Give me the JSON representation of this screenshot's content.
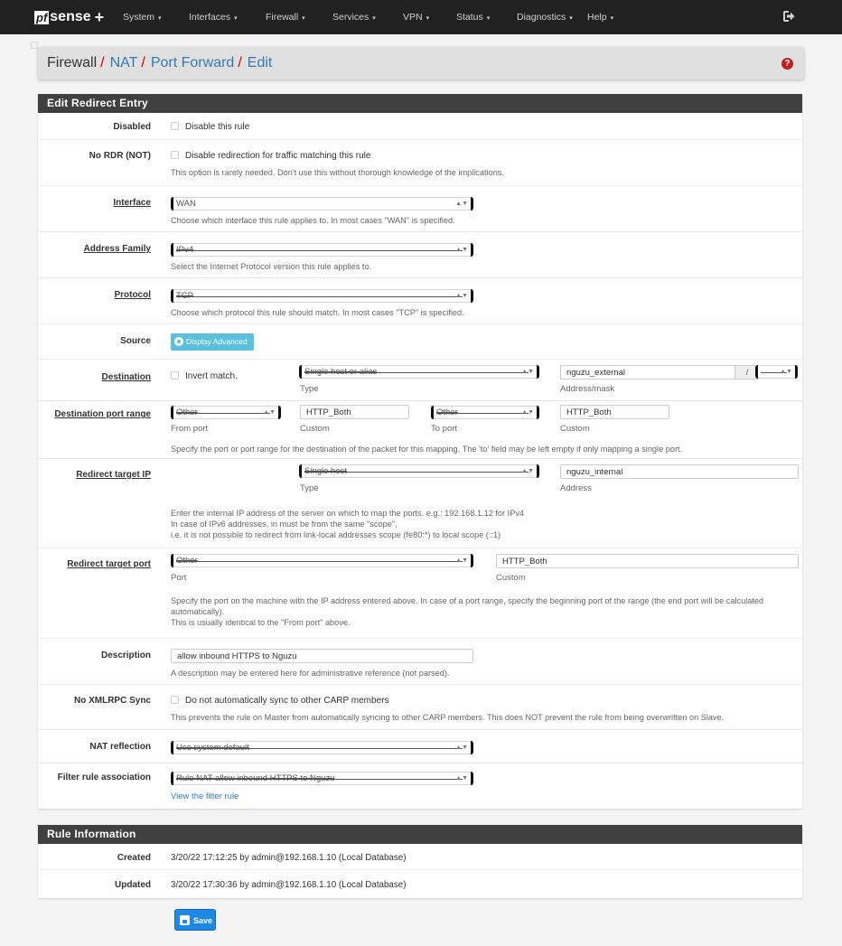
{
  "navbar": {
    "brand_pf": "pf",
    "brand_name": "sense",
    "brand_plus": "+",
    "menu": [
      "System",
      "Interfaces",
      "Firewall",
      "Services",
      "VPN",
      "Status",
      "Diagnostics",
      "Help"
    ],
    "caret": "▾",
    "logout_icon": "sign-out-icon"
  },
  "breadcrumb": {
    "items": [
      {
        "label": "Firewall",
        "link": false
      },
      {
        "label": "NAT",
        "link": true
      },
      {
        "label": "Port Forward",
        "link": true
      },
      {
        "label": "Edit",
        "link": true
      }
    ],
    "separator": "/",
    "help_icon": "?"
  },
  "colors": {
    "navbar_bg": "#212121",
    "panel_heading_bg": "#404040",
    "link": "#337ab7",
    "separator": "#cc0000",
    "info_button": "#5bc0de",
    "primary_button": "#1e88e5",
    "help_icon": "#c21e1e"
  },
  "edit_panel": {
    "title": "Edit Redirect Entry",
    "disabled": {
      "label": "Disabled",
      "checkbox_label": "Disable this rule",
      "checked": false
    },
    "no_rdr": {
      "label": "No RDR (NOT)",
      "checkbox_label": "Disable redirection for traffic matching this rule",
      "checked": false,
      "help": "This option is rarely needed. Don't use this without thorough knowledge of the implications."
    },
    "interface": {
      "label": "Interface",
      "value": "WAN",
      "help": "Choose which interface this rule applies to. In most cases \"WAN\" is specified."
    },
    "address_family": {
      "label": "Address Family",
      "value": "IPv4",
      "help": "Select the Internet Protocol version this rule applies to."
    },
    "protocol": {
      "label": "Protocol",
      "value": "TCP",
      "help": "Choose which protocol this rule should match. In most cases \"TCP\" is specified."
    },
    "source": {
      "label": "Source",
      "button": "Display Advanced"
    },
    "destination": {
      "label": "Destination",
      "invert_label": "Invert match.",
      "invert_checked": false,
      "type_value": "Single host or alias",
      "type_sub": "Type",
      "address_value": "nguzu_external",
      "mask_sep": "/",
      "mask_value": "",
      "address_sub": "Address/mask"
    },
    "dest_port_range": {
      "label": "Destination port range",
      "from_select": "Other",
      "from_sub": "From port",
      "from_custom": "HTTP_Both",
      "from_custom_sub": "Custom",
      "to_select": "Other",
      "to_sub": "To port",
      "to_custom": "HTTP_Both",
      "to_custom_sub": "Custom",
      "help": "Specify the port or port range for the destination of the packet for this mapping. The 'to' field may be left empty if only mapping a single port."
    },
    "redirect_ip": {
      "label": "Redirect target IP",
      "type_value": "Single host",
      "type_sub": "Type",
      "address_value": "nguzu_internal",
      "address_sub": "Address",
      "help_lines": [
        "Enter the internal IP address of the server on which to map the ports. e.g.: 192.168.1.12 for IPv4",
        "In case of IPv6 addresses, in must be from the same \"scope\",",
        "i.e. it is not possible to redirect from link-local addresses scope (fe80:*) to local scope (::1)"
      ]
    },
    "redirect_port": {
      "label": "Redirect target port",
      "select_value": "Other",
      "select_sub": "Port",
      "custom_value": "HTTP_Both",
      "custom_sub": "Custom",
      "help_lines": [
        "Specify the port on the machine with the IP address entered above. In case of a port range, specify the beginning port of the range (the end port will be calculated automatically).",
        "This is usually identical to the \"From port\" above."
      ]
    },
    "description": {
      "label": "Description",
      "value": "allow inbound HTTPS to Nguzu",
      "help": "A description may be entered here for administrative reference (not parsed)."
    },
    "no_xmlrpc": {
      "label": "No XMLRPC Sync",
      "checkbox_label": "Do not automatically sync to other CARP members",
      "checked": false,
      "help": "This prevents the rule on Master from automatically syncing to other CARP members. This does NOT prevent the rule from being overwritten on Slave."
    },
    "nat_reflection": {
      "label": "NAT reflection",
      "value": "Use system default"
    },
    "filter_rule": {
      "label": "Filter rule association",
      "value": "Rule NAT allow inbound HTTPS to Nguzu",
      "link": "View the filter rule"
    }
  },
  "rule_info": {
    "title": "Rule Information",
    "created_label": "Created",
    "created_value": "3/20/22 17:12:25 by admin@192.168.1.10 (Local Database)",
    "updated_label": "Updated",
    "updated_value": "3/20/22 17:30:36 by admin@192.168.1.10 (Local Database)"
  },
  "save_button": "Save"
}
